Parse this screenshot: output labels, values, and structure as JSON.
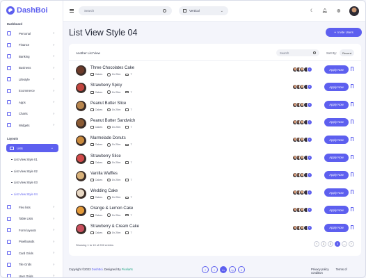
{
  "app": {
    "name": "DashBoi"
  },
  "topbar": {
    "search_placeholder": "Search",
    "layout_value": "Vertical"
  },
  "sidebar": {
    "dashboard_label": "Dashboard",
    "items": [
      {
        "label": "Personal",
        "icon": "user-icon"
      },
      {
        "label": "Finance",
        "icon": "wallet-icon"
      },
      {
        "label": "Banking",
        "icon": "bank-icon"
      },
      {
        "label": "Business",
        "icon": "briefcase-icon"
      },
      {
        "label": "Lifestyle",
        "icon": "heart-icon"
      },
      {
        "label": "Ecommerce",
        "icon": "cart-icon"
      },
      {
        "label": "Apps",
        "icon": "apps-icon"
      },
      {
        "label": "Charts",
        "icon": "chart-icon"
      },
      {
        "label": "Widgets",
        "icon": "widget-icon"
      }
    ],
    "layouts_label": "Layouts",
    "active": {
      "label": "Lists"
    },
    "subitems": [
      "List View Style 01",
      "List View Style 02",
      "List View Style 03",
      "List View Style 04"
    ],
    "items2": [
      {
        "label": "Flex lists"
      },
      {
        "label": "Table Lists"
      },
      {
        "label": "Form layouts"
      },
      {
        "label": "Pixelboards"
      },
      {
        "label": "Card Grids"
      },
      {
        "label": "Tile Grids"
      },
      {
        "label": "User Grids"
      }
    ]
  },
  "page": {
    "title": "List View Style 04",
    "invite_label": "Invite Users"
  },
  "card": {
    "subtitle": "Another List View",
    "search_placeholder": "Search",
    "sort_label": "Sort By:",
    "sort_value": "Recent",
    "showing": "Showing 1 to 10 of 200 entries"
  },
  "rows": [
    {
      "name": "Three Chocolates Cake",
      "category": "Cakes",
      "time": "1h 20m",
      "count": "7"
    },
    {
      "name": "Strawberry Spicy",
      "category": "Cakes",
      "time": "1h 20m",
      "count": "7"
    },
    {
      "name": "Peanut Butter Slice",
      "category": "Cakes",
      "time": "1h 20m",
      "count": "7"
    },
    {
      "name": "Peanut Butter Sandwich",
      "category": "Cakes",
      "time": "1h 20m",
      "count": "7"
    },
    {
      "name": "Marmelade Donuts",
      "category": "Cakes",
      "time": "1h 20m",
      "count": "7"
    },
    {
      "name": "Strawberry Slice",
      "category": "Cakes",
      "time": "1h 20m",
      "count": "7"
    },
    {
      "name": "Vanilla Waffles",
      "category": "Cakes",
      "time": "1h 20m",
      "count": "7"
    },
    {
      "name": "Wedding Cake",
      "category": "Cakes",
      "time": "1h 20m",
      "count": "7"
    },
    {
      "name": "Orange & Lemon Cake",
      "category": "Cakes",
      "time": "1h 20m",
      "count": "7"
    },
    {
      "name": "Strawberry & Cream Cake",
      "category": "Cakes",
      "time": "1h 20m",
      "count": "7"
    }
  ],
  "row_ui": {
    "apply_label": "Apply Now",
    "more_badge": "+"
  },
  "pagination": [
    "‹",
    "1",
    "2",
    "3",
    "...",
    "›"
  ],
  "footer": {
    "copy_prefix": "Copyright ©2023",
    "copy_app": "DashBoi",
    "copy_mid": ". Designed By",
    "copy_brand": "Pixelarts",
    "links": [
      "Privacy policy",
      "Terms of condition"
    ],
    "socials": [
      "f",
      "t",
      "in",
      "ig",
      "li"
    ]
  },
  "colors": {
    "accent": "#5d5fef",
    "brand": "#1fa383"
  }
}
